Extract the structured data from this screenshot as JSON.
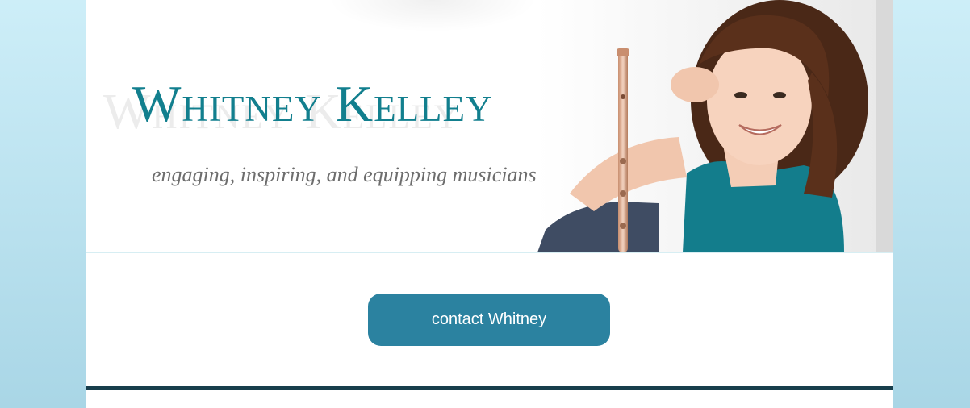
{
  "header": {
    "logo_title": "Whitney Kelley",
    "tagline": "engaging, inspiring, and equipping musicians"
  },
  "main": {
    "contact_button_label": "contact Whitney"
  },
  "colors": {
    "background_top": "#cdeef8",
    "background_bottom": "#a9d6e6",
    "logo_teal": "#127f8e",
    "button_blue": "#2b82a0",
    "footer_bar": "#183e4c"
  },
  "icons": {
    "hero_photo": "portrait-with-flute"
  }
}
